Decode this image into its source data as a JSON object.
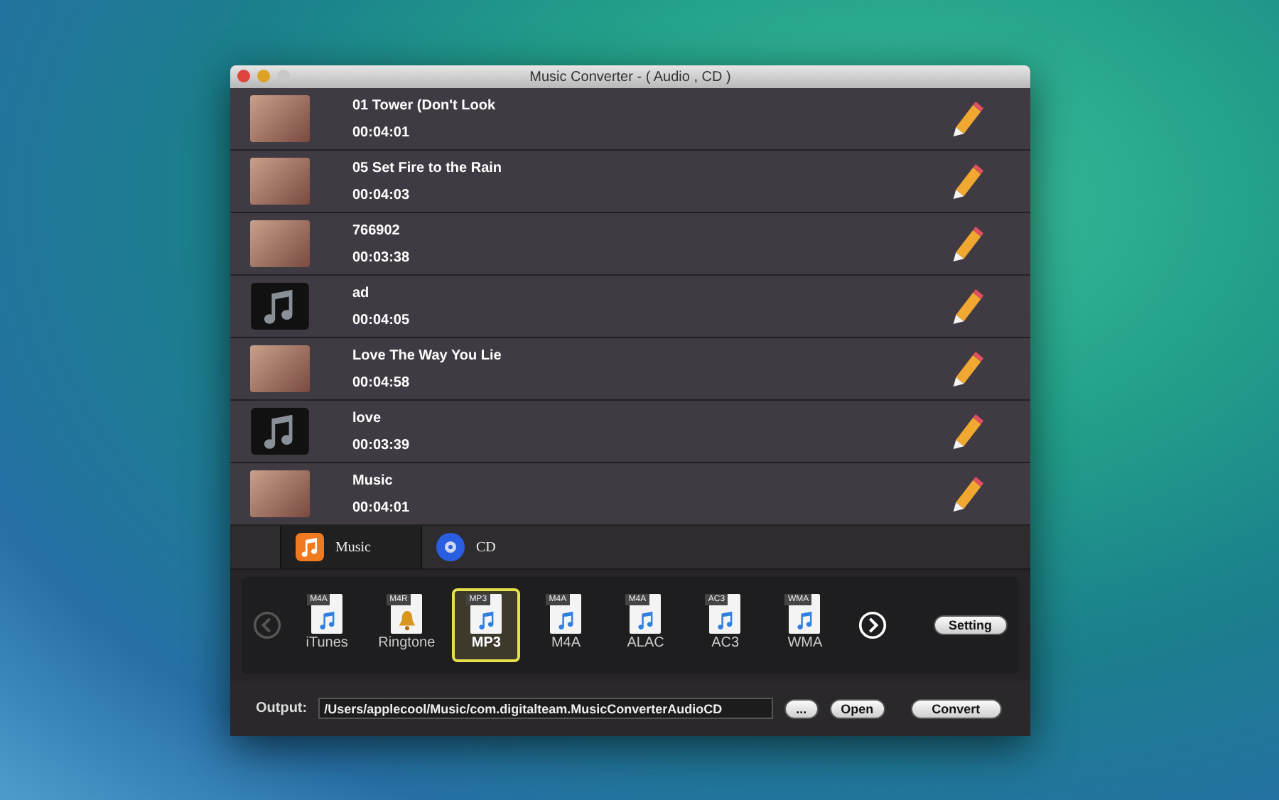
{
  "window": {
    "title": "Music Converter - ( Audio , CD )"
  },
  "tracks": [
    {
      "title": "01 Tower (Don't Look",
      "duration": "00:04:01",
      "kind": "photo"
    },
    {
      "title": "05 Set Fire to the Rain",
      "duration": "00:04:03",
      "kind": "photo"
    },
    {
      "title": "766902",
      "duration": "00:03:38",
      "kind": "photo"
    },
    {
      "title": "ad",
      "duration": "00:04:05",
      "kind": "note"
    },
    {
      "title": "Love The Way You Lie",
      "duration": "00:04:58",
      "kind": "photo"
    },
    {
      "title": "love",
      "duration": "00:03:39",
      "kind": "note"
    },
    {
      "title": "Music",
      "duration": "00:04:01",
      "kind": "photo"
    }
  ],
  "tabs": [
    {
      "label": "Music",
      "kind": "music",
      "selected": true
    },
    {
      "label": "CD",
      "kind": "cd",
      "selected": false
    }
  ],
  "formats": [
    {
      "badge": "M4A",
      "label": "iTunes",
      "kind": "note",
      "selected": false
    },
    {
      "badge": "M4R",
      "label": "Ringtone",
      "kind": "bell",
      "selected": false
    },
    {
      "badge": "MP3",
      "label": "MP3",
      "kind": "note",
      "selected": true
    },
    {
      "badge": "M4A",
      "label": "M4A",
      "kind": "note",
      "selected": false
    },
    {
      "badge": "M4A",
      "label": "ALAC",
      "kind": "note",
      "selected": false
    },
    {
      "badge": "AC3",
      "label": "AC3",
      "kind": "note",
      "selected": false
    },
    {
      "badge": "WMA",
      "label": "WMA",
      "kind": "note",
      "selected": false
    }
  ],
  "prev_disabled": true,
  "setting_button": "Setting",
  "output": {
    "label": "Output:",
    "value": "/Users/applecool/Music/com.digitalteam.MusicConverterAudioCD",
    "browse": "...",
    "open": "Open",
    "convert": "Convert"
  }
}
